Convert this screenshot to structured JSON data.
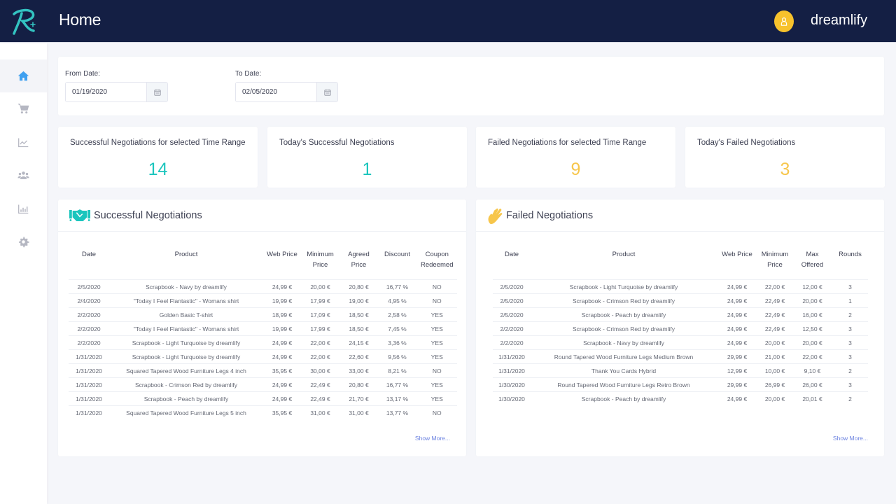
{
  "header": {
    "title": "Home",
    "username": "dreamlify",
    "brand_color": "#141f44",
    "accent_color": "#1bc5bd",
    "avatar_color": "#f7c22c"
  },
  "sidebar": {
    "items": [
      {
        "name": "home",
        "icon": "home-icon",
        "active": true
      },
      {
        "name": "shop",
        "icon": "cart-icon",
        "active": false
      },
      {
        "name": "trends",
        "icon": "line-chart-icon",
        "active": false
      },
      {
        "name": "users",
        "icon": "users-icon",
        "active": false
      },
      {
        "name": "reports",
        "icon": "bar-chart-icon",
        "active": false
      },
      {
        "name": "settings",
        "icon": "gear-icon",
        "active": false
      }
    ]
  },
  "filters": {
    "from_label": "From Date:",
    "from_value": "01/19/2020",
    "to_label": "To Date:",
    "to_value": "02/05/2020"
  },
  "stats": [
    {
      "title": "Successful Negotiations for selected Time Range",
      "value": "14",
      "type": "success"
    },
    {
      "title": "Today's Successful Negotiations",
      "value": "1",
      "type": "success"
    },
    {
      "title": "Failed Negotiations for selected Time Range",
      "value": "9",
      "type": "failed"
    },
    {
      "title": "Today's Failed Negotiations",
      "value": "3",
      "type": "failed"
    }
  ],
  "successful": {
    "title": "Successful Negotiations",
    "show_more": "Show More...",
    "columns": [
      "Date",
      "Product",
      "Web Price",
      "Minimum Price",
      "Agreed Price",
      "Discount",
      "Coupon Redeemed"
    ],
    "rows": [
      [
        "2/5/2020",
        "Scrapbook - Navy by dreamlify",
        "24,99 €",
        "20,00 €",
        "20,80 €",
        "16,77 %",
        "NO"
      ],
      [
        "2/4/2020",
        "\"Today I Feel Flantastic\" - Womans shirt",
        "19,99 €",
        "17,99 €",
        "19,00 €",
        "4,95 %",
        "NO"
      ],
      [
        "2/2/2020",
        "Golden Basic T-shirt",
        "18,99 €",
        "17,09 €",
        "18,50 €",
        "2,58 %",
        "YES"
      ],
      [
        "2/2/2020",
        "\"Today I Feel Flantastic\" - Womans shirt",
        "19,99 €",
        "17,99 €",
        "18,50 €",
        "7,45 %",
        "YES"
      ],
      [
        "2/2/2020",
        "Scrapbook - Light Turquoise by dreamlify",
        "24,99 €",
        "22,00 €",
        "24,15 €",
        "3,36 %",
        "YES"
      ],
      [
        "1/31/2020",
        "Scrapbook - Light Turquoise by dreamlify",
        "24,99 €",
        "22,00 €",
        "22,60 €",
        "9,56 %",
        "YES"
      ],
      [
        "1/31/2020",
        "Squared Tapered Wood Furniture Legs 4 inch",
        "35,95 €",
        "30,00 €",
        "33,00 €",
        "8,21 %",
        "NO"
      ],
      [
        "1/31/2020",
        "Scrapbook - Crimson Red by dreamlify",
        "24,99 €",
        "22,49 €",
        "20,80 €",
        "16,77 %",
        "YES"
      ],
      [
        "1/31/2020",
        "Scrapbook - Peach by dreamlify",
        "24,99 €",
        "22,49 €",
        "21,70 €",
        "13,17 %",
        "YES"
      ],
      [
        "1/31/2020",
        "Squared Tapered Wood Furniture Legs 5 inch",
        "35,95 €",
        "31,00 €",
        "31,00 €",
        "13,77 %",
        "NO"
      ]
    ]
  },
  "failed": {
    "title": "Failed Negotiations",
    "show_more": "Show More...",
    "columns": [
      "Date",
      "Product",
      "Web Price",
      "Minimum Price",
      "Max Offered",
      "Rounds"
    ],
    "rows": [
      [
        "2/5/2020",
        "Scrapbook - Light Turquoise by dreamlify",
        "24,99 €",
        "22,00 €",
        "12,00 €",
        "3"
      ],
      [
        "2/5/2020",
        "Scrapbook - Crimson Red by dreamlify",
        "24,99 €",
        "22,49 €",
        "20,00 €",
        "1"
      ],
      [
        "2/5/2020",
        "Scrapbook - Peach by dreamlify",
        "24,99 €",
        "22,49 €",
        "16,00 €",
        "2"
      ],
      [
        "2/2/2020",
        "Scrapbook - Crimson Red by dreamlify",
        "24,99 €",
        "22,49 €",
        "12,50 €",
        "3"
      ],
      [
        "2/2/2020",
        "Scrapbook - Navy by dreamlify",
        "24,99 €",
        "20,00 €",
        "20,00 €",
        "3"
      ],
      [
        "1/31/2020",
        "Round Tapered Wood Furniture Legs Medium Brown",
        "29,99 €",
        "21,00 €",
        "22,00 €",
        "3"
      ],
      [
        "1/31/2020",
        "Thank You Cards Hybrid",
        "12,99 €",
        "10,00 €",
        "9,10 €",
        "2"
      ],
      [
        "1/30/2020",
        "Round Tapered Wood Furniture Legs Retro Brown",
        "29,99 €",
        "26,99 €",
        "26,00 €",
        "3"
      ],
      [
        "1/30/2020",
        "Scrapbook - Peach by dreamlify",
        "24,99 €",
        "20,00 €",
        "20,01 €",
        "2"
      ]
    ]
  }
}
